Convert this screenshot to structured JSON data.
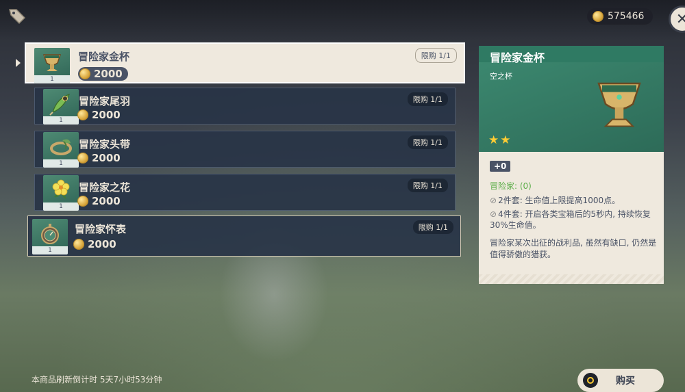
{
  "currency": {
    "amount": "575466",
    "icon": "mora-coin-icon"
  },
  "items": [
    {
      "name": "冒险家金杯",
      "price": "2000",
      "limit": "限购 1/1",
      "count": "1",
      "icon": "goblet-icon"
    },
    {
      "name": "冒险家尾羽",
      "price": "2000",
      "limit": "限购 1/1",
      "count": "1",
      "icon": "feather-icon"
    },
    {
      "name": "冒险家头带",
      "price": "2000",
      "limit": "限购 1/1",
      "count": "1",
      "icon": "circlet-icon"
    },
    {
      "name": "冒险家之花",
      "price": "2000",
      "limit": "限购 1/1",
      "count": "1",
      "icon": "flower-icon"
    },
    {
      "name": "冒险家怀表",
      "price": "2000",
      "limit": "限购 1/1",
      "count": "1",
      "icon": "pocket-watch-icon"
    }
  ],
  "detail": {
    "title": "冒险家金杯",
    "type": "空之杯",
    "stars": "★★",
    "level": "+0",
    "set_name": "冒险家: (0)",
    "set_2": "2件套: 生命值上限提高1000点。",
    "set_4": "4件套: 开启各类宝箱后的5秒内, 持续恢复30%生命值。",
    "flavor": "冒险家某次出征的战利品, 虽然有缺口, 仍然是值得骄傲的猎获。"
  },
  "footer": {
    "timer": "本商品刷新倒计时 5天7小时53分钟",
    "buy_label": "购买"
  },
  "colors": {
    "accent_green": "#2f7a63",
    "star": "#ffcc33",
    "panel": "#efe9de"
  }
}
